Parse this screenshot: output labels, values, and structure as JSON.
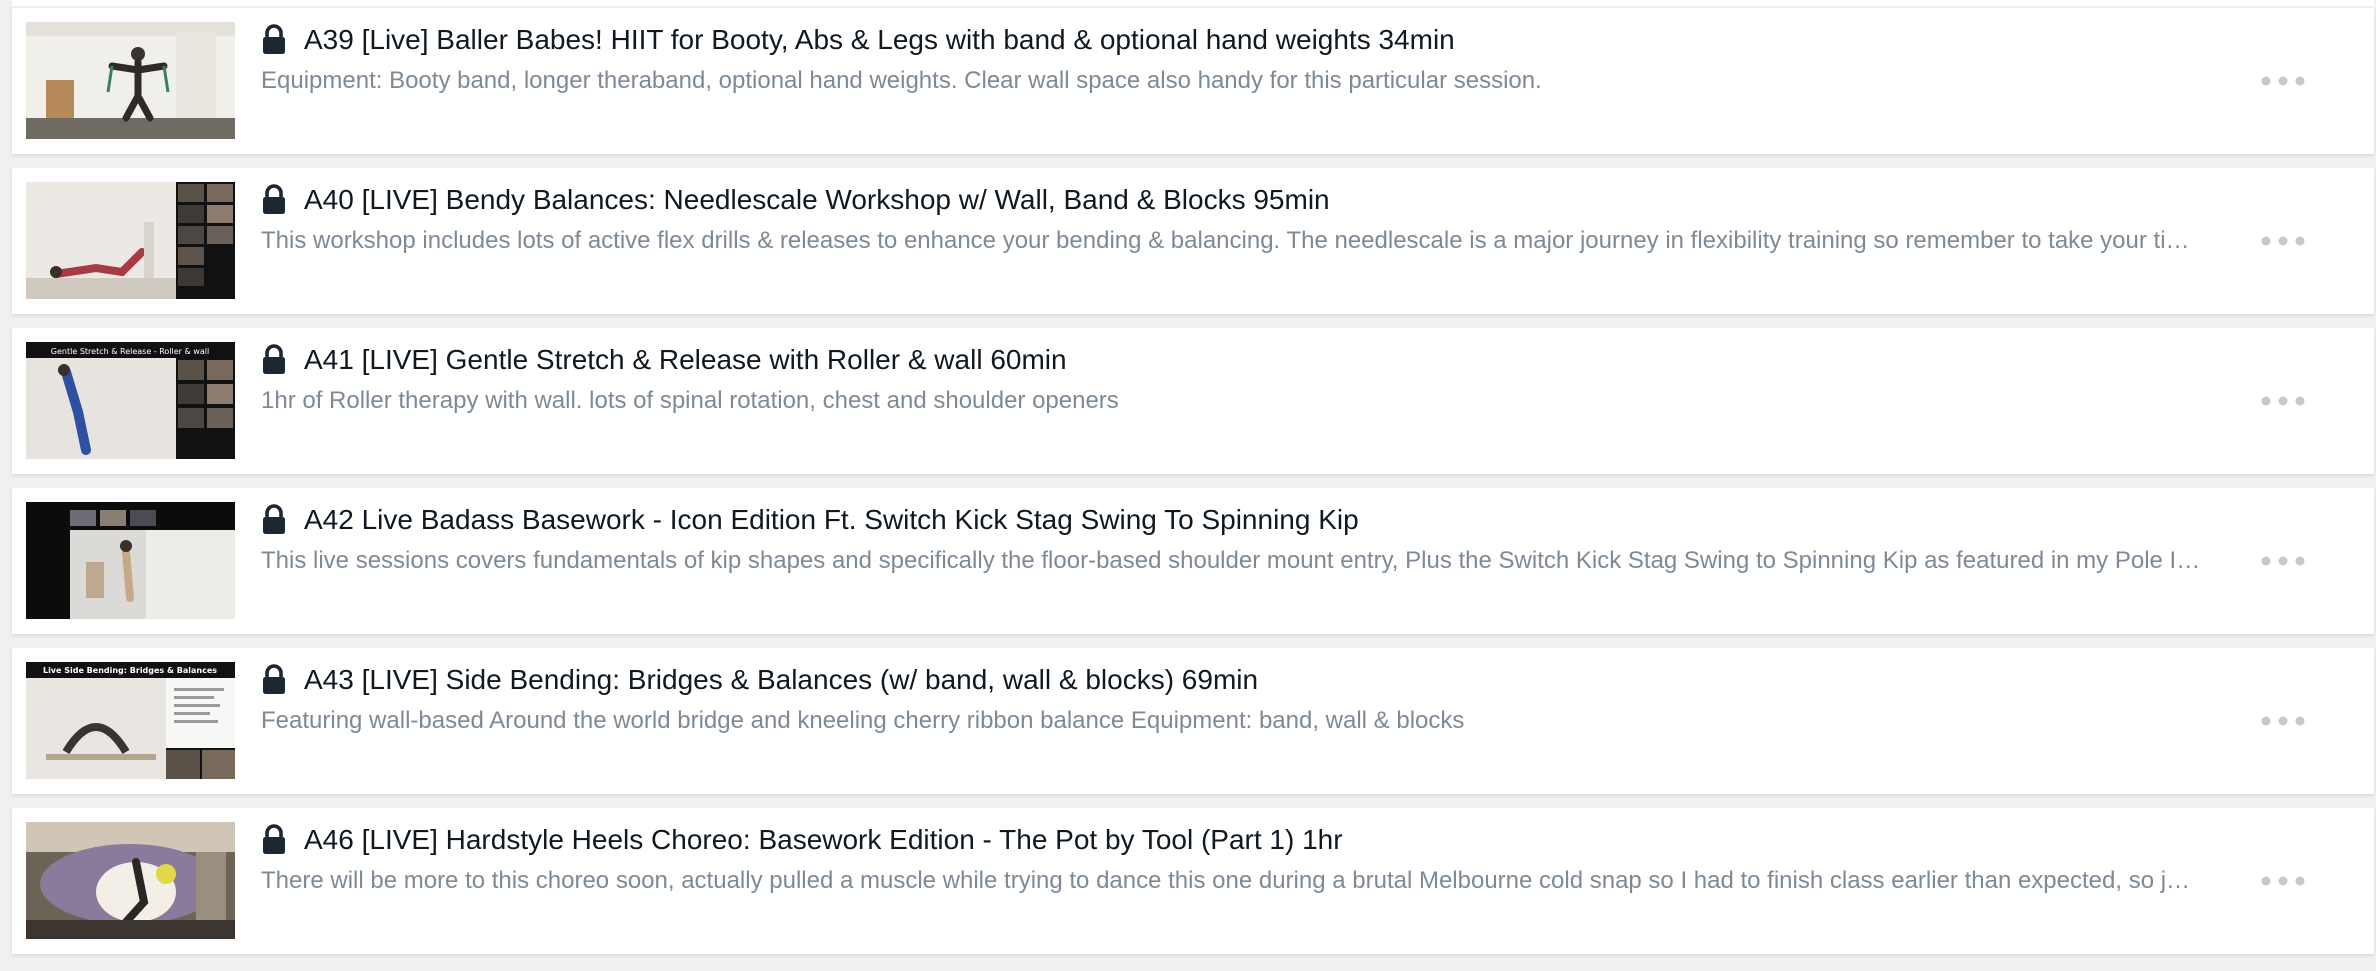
{
  "sessions": [
    {
      "title": "A39 [Live] Baller Babes! HIIT for Booty, Abs & Legs with band & optional hand weights 34min",
      "description": "Equipment: Booty band, longer theraband, optional hand weights. Clear wall space also handy for this particular session.",
      "thumbnail_caption": "",
      "locked": true
    },
    {
      "title": "A40 [LIVE] Bendy Balances: Needlescale Workshop w/ Wall, Band & Blocks 95min",
      "description": "This workshop includes lots of active flex drills & releases to enhance your bending & balancing. The needlescale is a major journey in flexibility training so remember to take your ti…",
      "thumbnail_caption": "",
      "locked": true
    },
    {
      "title": "A41 [LIVE] Gentle Stretch & Release with Roller & wall 60min",
      "description": "1hr of Roller therapy with wall. lots of spinal rotation, chest and shoulder openers",
      "thumbnail_caption": "Gentle Stretch & Release - Roller & wall",
      "locked": true
    },
    {
      "title": "A42 Live Badass Basework - Icon Edition Ft. Switch Kick Stag Swing To Spinning Kip",
      "description": "This live sessions covers fundamentals of kip shapes and specifically the floor-based shoulder mount entry, Plus the Switch Kick Stag Swing to Spinning Kip as featured in my Pole I…",
      "thumbnail_caption": "",
      "locked": true
    },
    {
      "title": "A43 [LIVE] Side Bending: Bridges & Balances (w/ band, wall & blocks) 69min",
      "description": "Featuring wall-based Around the world bridge and kneeling cherry ribbon balance Equipment: band, wall & blocks",
      "thumbnail_caption": "Live Side Bending: Bridges & Balances",
      "locked": true
    },
    {
      "title": "A46 [LIVE] Hardstyle Heels Choreo: Basework Edition - The Pot by Tool (Part 1) 1hr",
      "description": "There will be more to this choreo soon, actually pulled a muscle while trying to dance this one during a brutal Melbourne cold snap so I had to finish class earlier than expected, so j…",
      "thumbnail_caption": "",
      "locked": true
    }
  ],
  "icons": {
    "lock": "lock-icon",
    "more": "more-options-icon"
  },
  "colors": {
    "title": "#101820",
    "description": "#7d8a96",
    "lock": "#1c2733",
    "more_dots": "#c3c9cf",
    "background": "#eef0f2",
    "card": "#ffffff"
  }
}
